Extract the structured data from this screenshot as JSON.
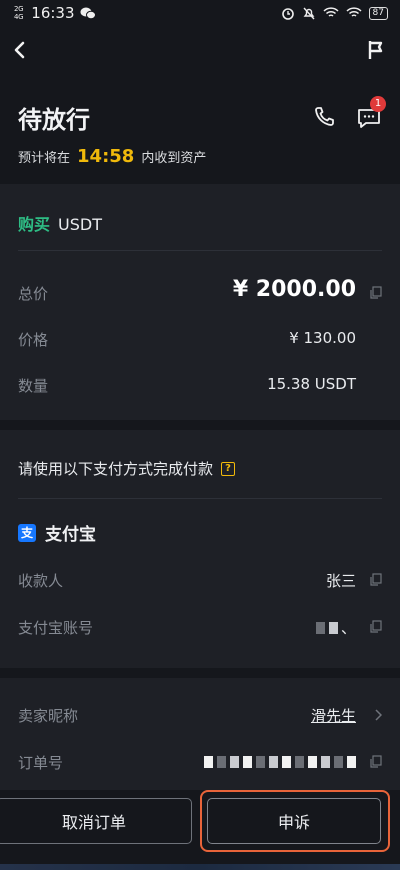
{
  "status_bar": {
    "signal": [
      "2G",
      "4G"
    ],
    "time": "16:33",
    "battery": "87",
    "icons": [
      "wechat-icon",
      "alarm-icon",
      "mute-icon",
      "wifi-icon",
      "wifi-icon",
      "battery-icon"
    ]
  },
  "nav": {
    "back_icon": "back-icon",
    "flag_icon": "flag-icon"
  },
  "header": {
    "title": "待放行",
    "subtitle_prefix": "预计将在",
    "countdown": "14:58",
    "subtitle_suffix": "内收到资产",
    "message_badge": "1"
  },
  "order": {
    "side": "购买",
    "asset": "USDT",
    "rows": [
      {
        "label": "总价",
        "value": "¥ 2000.00"
      },
      {
        "label": "价格",
        "value": "¥ 130.00"
      },
      {
        "label": "数量",
        "value": "15.38 USDT"
      }
    ]
  },
  "payment": {
    "title": "请使用以下支付方式完成付款",
    "help_icon": "?",
    "method": "支付宝",
    "method_icon": "支",
    "rows": [
      {
        "label": "收款人",
        "value": "张三"
      },
      {
        "label": "支付宝账号",
        "value": "、"
      }
    ]
  },
  "details": {
    "rows": [
      {
        "label": "卖家昵称",
        "value": "滑先生"
      },
      {
        "label": "订单号",
        "value": ""
      }
    ]
  },
  "actions": {
    "cancel": "取消订单",
    "appeal": "申诉"
  },
  "colors": {
    "accent": "#f0b90b",
    "buy": "#2ebd85",
    "badge": "#e03a3a",
    "highlight": "#e8643a"
  }
}
